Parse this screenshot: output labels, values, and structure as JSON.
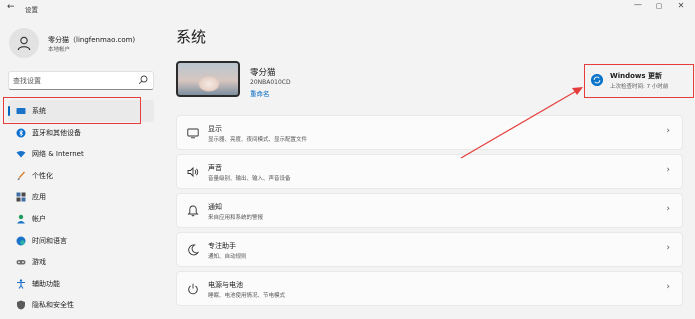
{
  "titlebar": {
    "back": "←",
    "title": "设置",
    "minimize": "—",
    "maximize": "▢",
    "close": "✕"
  },
  "profile": {
    "name": "零分猫（lingfenmao.com)",
    "account_type": "本地帐户"
  },
  "search": {
    "placeholder": "查找设置"
  },
  "sidebar": {
    "items": [
      {
        "label": "系统",
        "icon": "monitor-icon",
        "active": true
      },
      {
        "label": "蓝牙和其他设备",
        "icon": "bluetooth-icon"
      },
      {
        "label": "网络 & Internet",
        "icon": "network-icon"
      },
      {
        "label": "个性化",
        "icon": "brush-icon"
      },
      {
        "label": "应用",
        "icon": "apps-icon"
      },
      {
        "label": "帐户",
        "icon": "person-icon"
      },
      {
        "label": "时间和语言",
        "icon": "globe-clock-icon"
      },
      {
        "label": "游戏",
        "icon": "gamepad-icon"
      },
      {
        "label": "辅助功能",
        "icon": "accessibility-icon"
      },
      {
        "label": "隐私和安全性",
        "icon": "shield-icon"
      }
    ]
  },
  "main": {
    "title": "系统",
    "device": {
      "name": "零分猫",
      "model": "20NBA010CD",
      "rename": "重命名"
    },
    "update": {
      "title": "Windows 更新",
      "subtitle": "上次检查时间: 7 小时前"
    },
    "settings": [
      {
        "title": "显示",
        "desc": "显示器、亮度、夜间模式、显示配置文件",
        "icon": "display-icon"
      },
      {
        "title": "声音",
        "desc": "音量级别、输出、输入、声音设备",
        "icon": "speaker-icon"
      },
      {
        "title": "通知",
        "desc": "来自应用和系统的警报",
        "icon": "bell-icon"
      },
      {
        "title": "专注助手",
        "desc": "通知、自动规则",
        "icon": "moon-icon"
      },
      {
        "title": "电源与电池",
        "desc": "睡眠、电池使用情况、节电模式",
        "icon": "power-icon"
      }
    ],
    "chevron": "›"
  },
  "colors": {
    "accent": "#0067c0",
    "highlight": "#e53c3c",
    "background": "#f3f3f3"
  }
}
